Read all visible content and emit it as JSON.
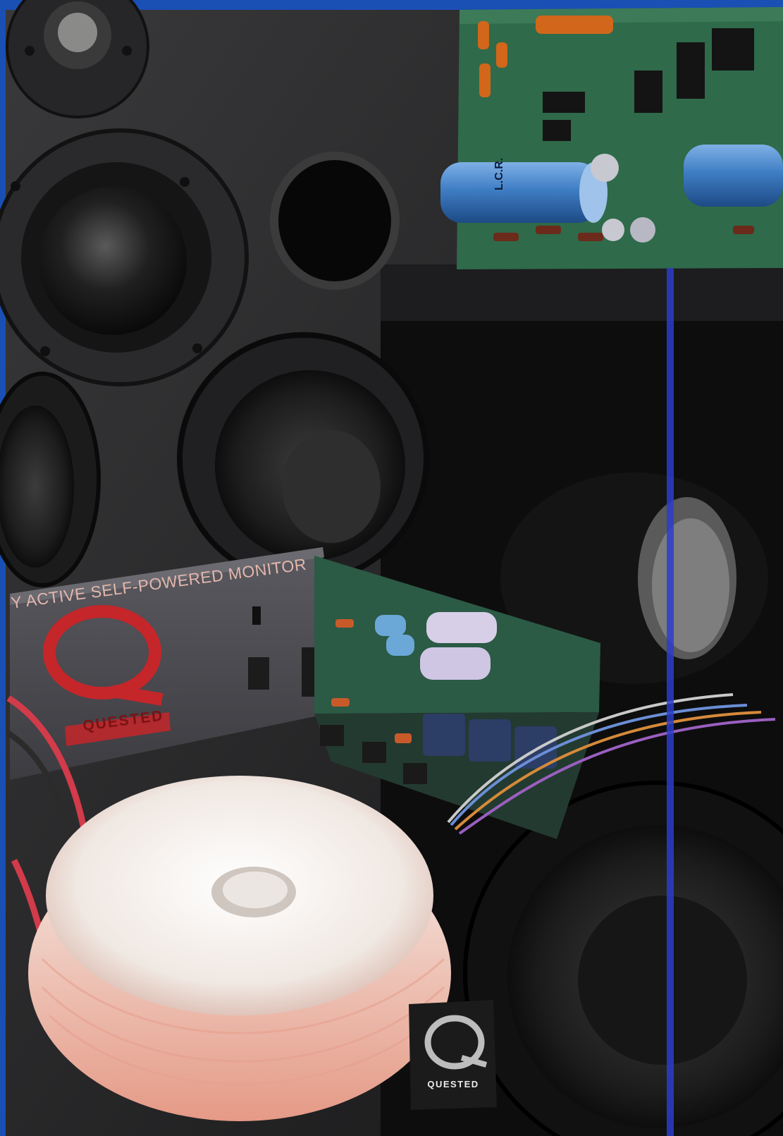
{
  "photo": {
    "faceplate_title": "Y ACTIVE SELF-POWERED MONITOR",
    "faceplate_brand": "QUESTED",
    "badge_brand": "QUESTED",
    "capacitor_label": "L.C.R."
  },
  "colors": {
    "border": "#1a4fb4",
    "cabinet": "#2b2b2d",
    "pcb": "#2f6a4a",
    "faceplate": "#4a4a4f",
    "logo_red": "#c4262a",
    "transformer": "#f2ece6",
    "transformer_stripe": "#e7a08e",
    "capacitor_blue": "#3f7ec4"
  }
}
